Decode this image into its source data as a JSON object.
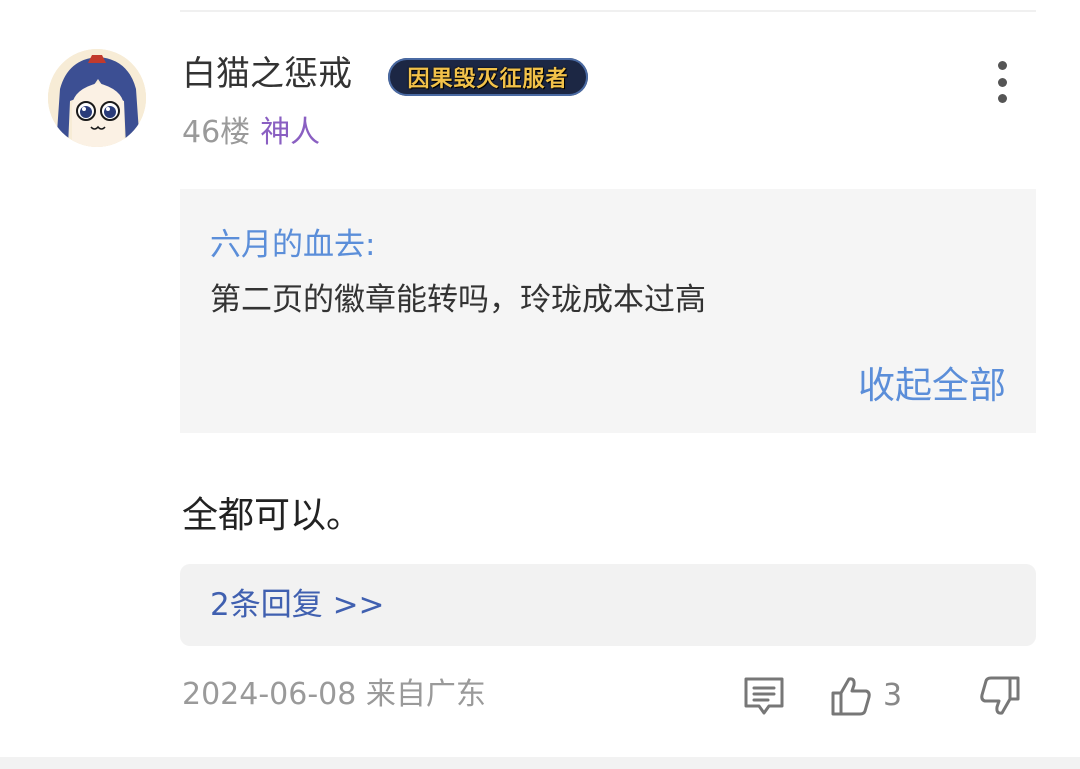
{
  "post": {
    "username": "白猫之惩戒",
    "badge_text": "因果毁灭征服者",
    "floor": "46楼",
    "rank": "神人",
    "quote": {
      "author": "六月的血去:",
      "text": "第二页的徽章能转吗，玲珑成本过高",
      "collapse_label": "收起全部"
    },
    "body": "全都可以。",
    "replies_label": "2条回复 >>",
    "date": "2024-06-08",
    "location": "来自广东",
    "like_count": "3"
  },
  "icons": {
    "more": "more-vertical-icon",
    "comment": "comment-icon",
    "like": "thumbs-up-icon",
    "dislike": "thumbs-down-icon"
  },
  "colors": {
    "link_blue": "#5b8ed9",
    "reply_blue": "#4060b0",
    "rank_purple": "#8a5fc2",
    "muted_gray": "#9a9a9a",
    "quote_bg": "#f5f5f5",
    "badge_bg": "#1c2744",
    "badge_text": "#f2c24a"
  }
}
